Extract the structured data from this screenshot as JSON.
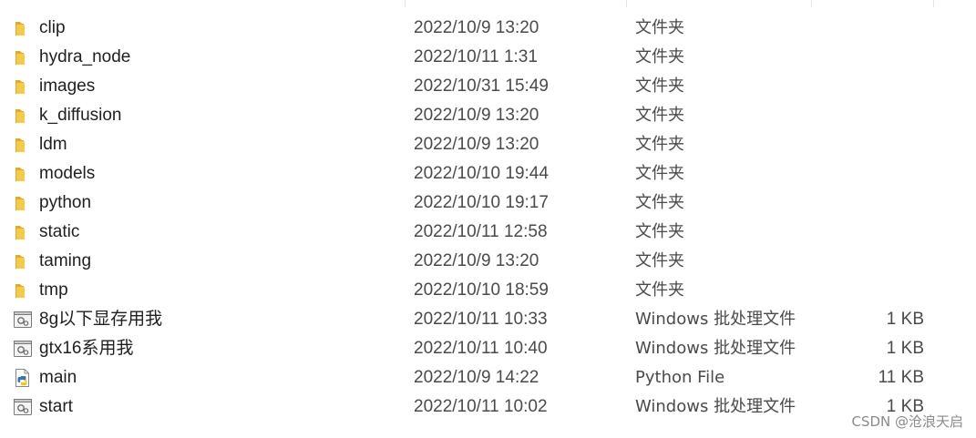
{
  "files": [
    {
      "name": "clip",
      "date": "2022/10/9 13:20",
      "type": "文件夹",
      "size": "",
      "icon": "folder-icon"
    },
    {
      "name": "hydra_node",
      "date": "2022/10/11 1:31",
      "type": "文件夹",
      "size": "",
      "icon": "folder-icon"
    },
    {
      "name": "images",
      "date": "2022/10/31 15:49",
      "type": "文件夹",
      "size": "",
      "icon": "folder-icon"
    },
    {
      "name": "k_diffusion",
      "date": "2022/10/9 13:20",
      "type": "文件夹",
      "size": "",
      "icon": "folder-icon"
    },
    {
      "name": "ldm",
      "date": "2022/10/9 13:20",
      "type": "文件夹",
      "size": "",
      "icon": "folder-icon"
    },
    {
      "name": "models",
      "date": "2022/10/10 19:44",
      "type": "文件夹",
      "size": "",
      "icon": "folder-icon"
    },
    {
      "name": "python",
      "date": "2022/10/10 19:17",
      "type": "文件夹",
      "size": "",
      "icon": "folder-icon"
    },
    {
      "name": "static",
      "date": "2022/10/11 12:58",
      "type": "文件夹",
      "size": "",
      "icon": "folder-icon"
    },
    {
      "name": "taming",
      "date": "2022/10/9 13:20",
      "type": "文件夹",
      "size": "",
      "icon": "folder-icon"
    },
    {
      "name": "tmp",
      "date": "2022/10/10 18:59",
      "type": "文件夹",
      "size": "",
      "icon": "folder-icon"
    },
    {
      "name": "8g以下显存用我",
      "date": "2022/10/11 10:33",
      "type": "Windows 批处理文件",
      "size": "1 KB",
      "icon": "batch-file-icon"
    },
    {
      "name": "gtx16系用我",
      "date": "2022/10/11 10:40",
      "type": "Windows 批处理文件",
      "size": "1 KB",
      "icon": "batch-file-icon"
    },
    {
      "name": "main",
      "date": "2022/10/9 14:22",
      "type": "Python File",
      "size": "11 KB",
      "icon": "python-file-icon"
    },
    {
      "name": "start",
      "date": "2022/10/11 10:02",
      "type": "Windows 批处理文件",
      "size": "1 KB",
      "icon": "batch-file-icon"
    }
  ],
  "watermark": "CSDN @沧浪天启",
  "colors": {
    "folder": "#f8c84a",
    "folder_dark": "#e3a92a",
    "row_hover": "#e5f3ff"
  }
}
